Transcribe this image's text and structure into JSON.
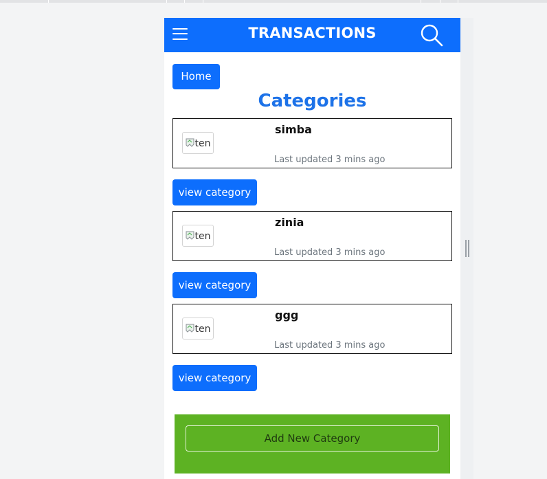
{
  "app": {
    "title": "TRANSACTIONS"
  },
  "nav": {
    "home_label": "Home"
  },
  "page": {
    "heading": "Categories"
  },
  "categories": [
    {
      "name": "simba",
      "image_alt": "ten",
      "updated": "Last updated 3 mins ago",
      "action_label": "view category"
    },
    {
      "name": "zinia",
      "image_alt": "ten",
      "updated": "Last updated 3 mins ago",
      "action_label": "view category"
    },
    {
      "name": "ggg",
      "image_alt": "ten",
      "updated": "Last updated 3 mins ago",
      "action_label": "view category"
    }
  ],
  "footer": {
    "add_label": "Add New Category"
  },
  "colors": {
    "primary": "#0d6efd",
    "heading": "#1d72e8",
    "footer_bg": "#5db223"
  },
  "icons": {
    "menu": "hamburger-icon",
    "search": "search-icon",
    "broken_image": "broken-image-icon"
  }
}
